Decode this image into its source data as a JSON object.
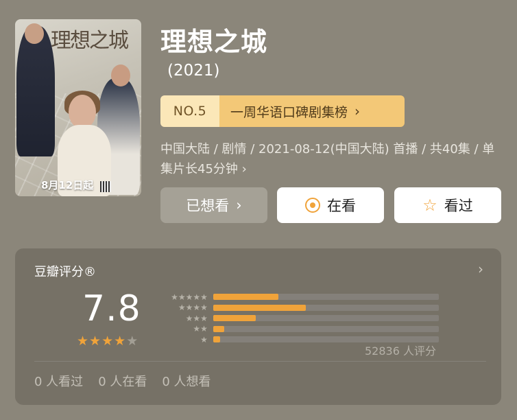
{
  "title": "理想之城",
  "year": "(2021)",
  "poster": {
    "title_text": "理想之城",
    "release_badge": "8月12日起"
  },
  "rank": {
    "number": "NO.5",
    "list_name": "一周华语口碑剧集榜",
    "chevron": "›"
  },
  "meta": {
    "text": "中国大陆 / 剧情 / 2021-08-12(中国大陆) 首播 / 共40集 / 单集片长45分钟",
    "chevron": "›"
  },
  "actions": {
    "wish_label": "已想看",
    "wish_chevron": "›",
    "doing_label": "在看",
    "done_label": "看过"
  },
  "rating": {
    "header": "豆瓣评分®",
    "header_chevron": "›",
    "score": "7.8",
    "score_stars_filled": 4,
    "score_stars_total": 5,
    "distribution": [
      {
        "stars": 5,
        "fraction": 0.29
      },
      {
        "stars": 4,
        "fraction": 0.41
      },
      {
        "stars": 3,
        "fraction": 0.19
      },
      {
        "stars": 2,
        "fraction": 0.05
      },
      {
        "stars": 1,
        "fraction": 0.03
      }
    ],
    "count_text": "52836 人评分"
  },
  "stats": {
    "watched": "0 人看过",
    "watching": "0 人在看",
    "wish": "0 人想看"
  },
  "colors": {
    "background": "#8b867a",
    "accent_orange": "#f0a33a",
    "rank_left": "#fbe7b8",
    "rank_right": "#f3c877",
    "card_bg": "#767166"
  }
}
